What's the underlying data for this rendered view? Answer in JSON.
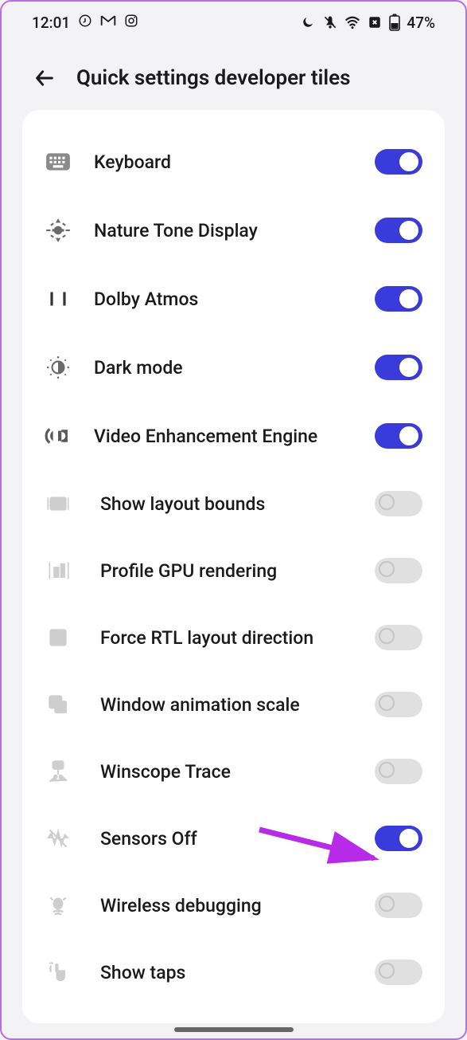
{
  "status_bar": {
    "time": "12:01",
    "battery_text": "47%"
  },
  "header": {
    "title": "Quick settings developer tiles"
  },
  "tiles": [
    {
      "id": "keyboard",
      "label": "Keyboard",
      "on": true,
      "dim": false,
      "indent": false
    },
    {
      "id": "nature-tone",
      "label": "Nature Tone Display",
      "on": true,
      "dim": false,
      "indent": false
    },
    {
      "id": "dolby-atmos",
      "label": "Dolby Atmos",
      "on": true,
      "dim": false,
      "indent": false
    },
    {
      "id": "dark-mode",
      "label": "Dark mode",
      "on": true,
      "dim": false,
      "indent": false
    },
    {
      "id": "video-enhance",
      "label": "Video Enhancement Engine",
      "on": true,
      "dim": false,
      "indent": false
    },
    {
      "id": "layout-bounds",
      "label": "Show layout bounds",
      "on": false,
      "dim": true,
      "indent": true
    },
    {
      "id": "gpu-render",
      "label": "Profile GPU rendering",
      "on": false,
      "dim": true,
      "indent": true
    },
    {
      "id": "force-rtl",
      "label": "Force RTL layout direction",
      "on": false,
      "dim": true,
      "indent": true
    },
    {
      "id": "window-anim",
      "label": "Window animation scale",
      "on": false,
      "dim": true,
      "indent": true
    },
    {
      "id": "winscope",
      "label": "Winscope Trace",
      "on": false,
      "dim": true,
      "indent": true
    },
    {
      "id": "sensors-off",
      "label": "Sensors Off",
      "on": true,
      "dim": true,
      "indent": true
    },
    {
      "id": "wireless-debug",
      "label": "Wireless debugging",
      "on": false,
      "dim": true,
      "indent": true
    },
    {
      "id": "show-taps",
      "label": "Show taps",
      "on": false,
      "dim": true,
      "indent": true
    }
  ]
}
